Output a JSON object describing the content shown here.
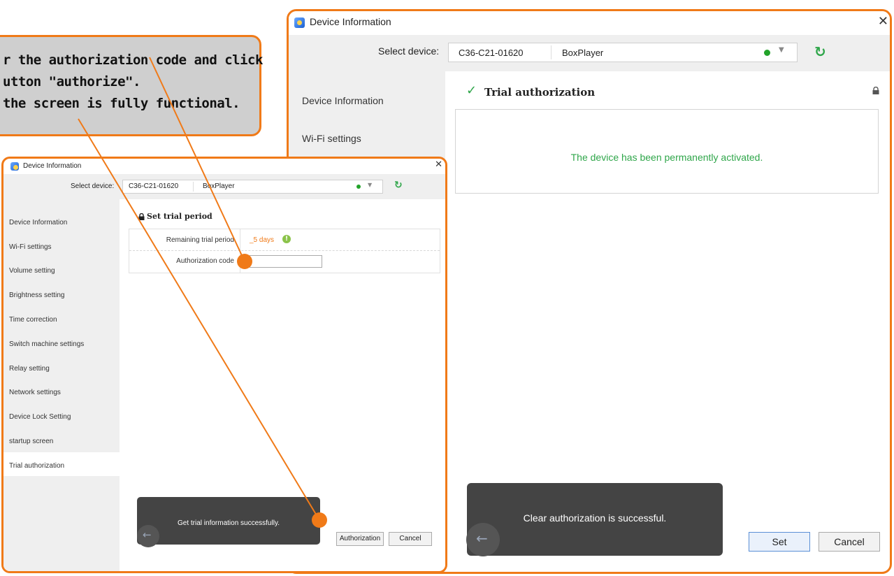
{
  "callout": {
    "line1": "r the authorization code and click",
    "line2": "utton \"authorize\".",
    "line3": "the screen is fully functional."
  },
  "big_window": {
    "title": "Device Information",
    "select_label": "Select device:",
    "device_id": "C36-C21-01620",
    "device_name": "BoxPlayer",
    "sidebar": [
      "Device Information",
      "Wi-Fi settings"
    ],
    "section_title": "Trial authorization",
    "message": "The device has been permanently activated.",
    "toast": "Clear authorization is successful.",
    "set_button": "Set",
    "cancel_button": "Cancel"
  },
  "small_window": {
    "title": "Device Information",
    "select_label": "Select device:",
    "device_id": "C36-C21-01620",
    "device_name": "BoxPlayer",
    "sidebar": [
      "Device Information",
      "Wi-Fi settings",
      "Volume setting",
      "Brightness setting",
      "Time correction",
      "Switch machine settings",
      "Relay setting",
      "Network settings",
      "Device Lock Setting",
      "startup screen",
      "Trial authorization"
    ],
    "section_title": "Set trial period",
    "remaining_label": "Remaining trial period",
    "remaining_value": "_5 days",
    "auth_label": "Authorization code",
    "auth_value": "",
    "toast": "Get trial information successfully.",
    "authorization_button": "Authorization",
    "cancel_button": "Cancel"
  },
  "colors": {
    "accent": "#f07a18",
    "success": "#2fa64a",
    "toast_bg": "#444444"
  }
}
